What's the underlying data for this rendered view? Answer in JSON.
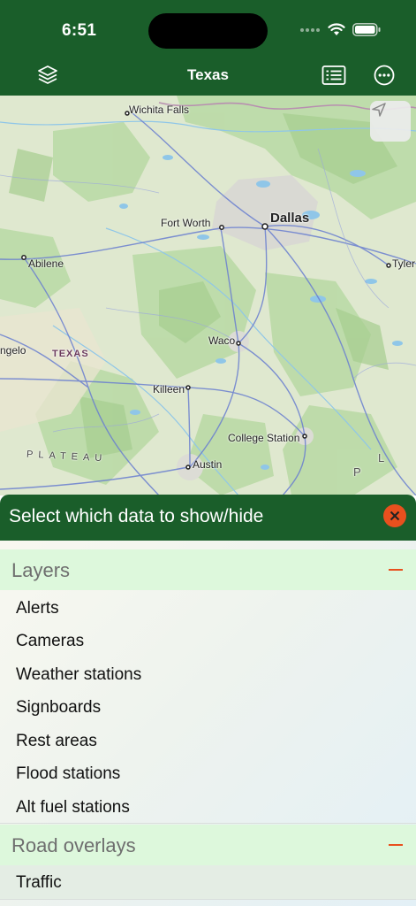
{
  "status": {
    "time": "6:51"
  },
  "nav": {
    "title": "Texas",
    "left_icon": "layers-icon",
    "right_icons": [
      "list-icon",
      "more-icon"
    ]
  },
  "map": {
    "labels": {
      "wichita_falls": "Wichita Falls",
      "fort_worth": "Fort Worth",
      "dallas": "Dallas",
      "abilene": "Abilene",
      "tyler": "Tyler",
      "angelo": "ngelo",
      "texas": "TEXAS",
      "waco": "Waco",
      "killeen": "Killeen",
      "college_station": "College Station",
      "plateau": "PLATEAU",
      "austin": "Austin",
      "p_letter": "P",
      "l_letter": "L"
    },
    "locate_icon": "location-arrow-icon"
  },
  "panel": {
    "title": "Select which data to show/hide",
    "close_icon": "close-icon",
    "sections": [
      {
        "title": "Layers",
        "items": [
          "Alerts",
          "Cameras",
          "Weather stations",
          "Signboards",
          "Rest areas",
          "Flood stations",
          "Alt fuel stations"
        ]
      },
      {
        "title": "Road overlays",
        "items": [
          "Traffic"
        ]
      }
    ]
  },
  "colors": {
    "brand_green": "#1a5e2a",
    "accent_orange": "#e8501e",
    "section_bg": "#ddf8dc"
  }
}
